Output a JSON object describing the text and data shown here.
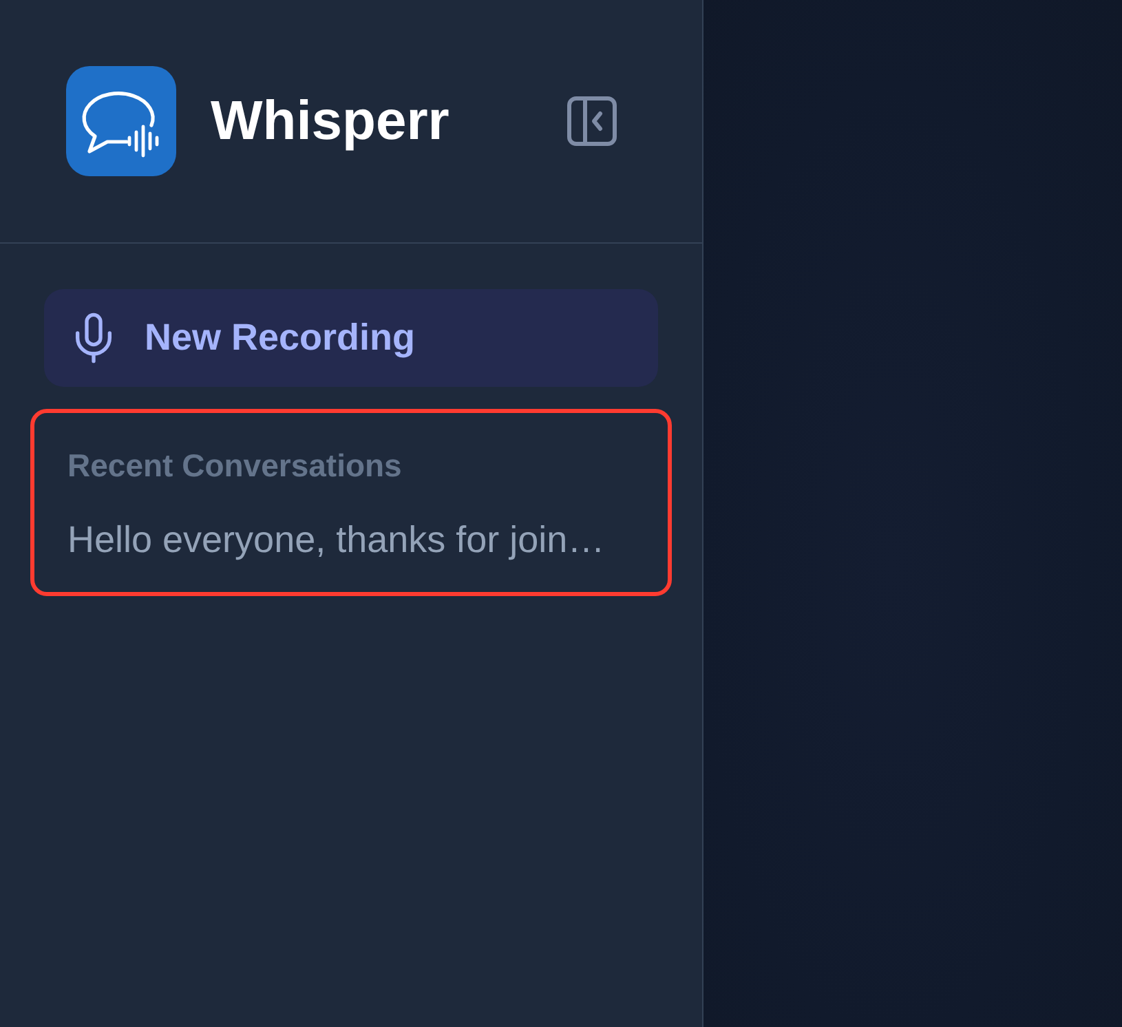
{
  "sidebar": {
    "app_name": "Whisperr",
    "new_recording_button": {
      "label": "New Recording"
    },
    "recent_conversations": {
      "highlighted": true,
      "heading": "Recent Conversations",
      "items": [
        {
          "title": "Hello everyone, thanks for join…",
          "selected": false
        }
      ]
    }
  }
}
